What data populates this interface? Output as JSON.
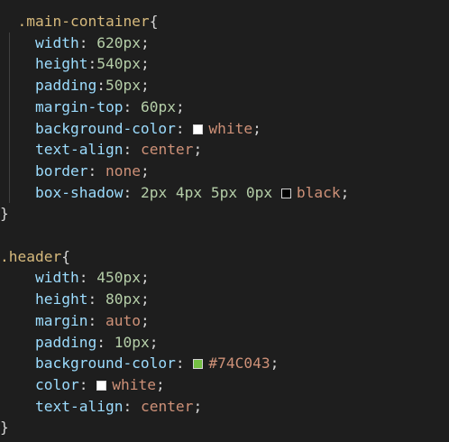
{
  "editor": {
    "lines": [
      [
        {
          "t": "  .main-container",
          "c": "selector"
        },
        {
          "t": "{",
          "c": "brace"
        }
      ],
      [
        {
          "t": "    width",
          "c": "prop"
        },
        {
          "t": ": ",
          "c": "colon"
        },
        {
          "t": "620px",
          "c": "num"
        },
        {
          "t": ";",
          "c": "semi"
        }
      ],
      [
        {
          "t": "    height",
          "c": "prop"
        },
        {
          "t": ":",
          "c": "colon"
        },
        {
          "t": "540px",
          "c": "num"
        },
        {
          "t": ";",
          "c": "semi"
        }
      ],
      [
        {
          "t": "    padding",
          "c": "prop"
        },
        {
          "t": ":",
          "c": "colon"
        },
        {
          "t": "50px",
          "c": "num"
        },
        {
          "t": ";",
          "c": "semi"
        }
      ],
      [
        {
          "t": "    margin-top",
          "c": "prop"
        },
        {
          "t": ": ",
          "c": "colon"
        },
        {
          "t": "60px",
          "c": "num"
        },
        {
          "t": ";",
          "c": "semi"
        }
      ],
      [
        {
          "t": "    background-color",
          "c": "prop"
        },
        {
          "t": ": ",
          "c": "colon"
        },
        {
          "swatch": "#ffffff"
        },
        {
          "t": "white",
          "c": "kw"
        },
        {
          "t": ";",
          "c": "semi"
        }
      ],
      [
        {
          "t": "    text-align",
          "c": "prop"
        },
        {
          "t": ": ",
          "c": "colon"
        },
        {
          "t": "center",
          "c": "kw"
        },
        {
          "t": ";",
          "c": "semi"
        }
      ],
      [
        {
          "t": "    border",
          "c": "prop"
        },
        {
          "t": ": ",
          "c": "colon"
        },
        {
          "t": "none",
          "c": "kw"
        },
        {
          "t": ";",
          "c": "semi"
        }
      ],
      [
        {
          "t": "    box-shadow",
          "c": "prop"
        },
        {
          "t": ": ",
          "c": "colon"
        },
        {
          "t": "2px 4px 5px 0px ",
          "c": "num"
        },
        {
          "swatch": "#000000"
        },
        {
          "t": "black",
          "c": "kw"
        },
        {
          "t": ";",
          "c": "semi"
        }
      ],
      [
        {
          "t": "}",
          "c": "brace"
        }
      ],
      [],
      [
        {
          "t": ".header",
          "c": "selector"
        },
        {
          "t": "{",
          "c": "brace"
        }
      ],
      [
        {
          "t": "    width",
          "c": "prop"
        },
        {
          "t": ": ",
          "c": "colon"
        },
        {
          "t": "450px",
          "c": "num"
        },
        {
          "t": ";",
          "c": "semi"
        }
      ],
      [
        {
          "t": "    height",
          "c": "prop"
        },
        {
          "t": ": ",
          "c": "colon"
        },
        {
          "t": "80px",
          "c": "num"
        },
        {
          "t": ";",
          "c": "semi"
        }
      ],
      [
        {
          "t": "    margin",
          "c": "prop"
        },
        {
          "t": ": ",
          "c": "colon"
        },
        {
          "t": "auto",
          "c": "kw"
        },
        {
          "t": ";",
          "c": "semi"
        }
      ],
      [
        {
          "t": "    padding",
          "c": "prop"
        },
        {
          "t": ": ",
          "c": "colon"
        },
        {
          "t": "10px",
          "c": "num"
        },
        {
          "t": ";",
          "c": "semi"
        }
      ],
      [
        {
          "t": "    background-color",
          "c": "prop"
        },
        {
          "t": ": ",
          "c": "colon"
        },
        {
          "swatch": "#74C043"
        },
        {
          "t": "#74C043",
          "c": "kw"
        },
        {
          "t": ";",
          "c": "semi"
        }
      ],
      [
        {
          "t": "    color",
          "c": "prop"
        },
        {
          "t": ": ",
          "c": "colon"
        },
        {
          "swatch": "#ffffff"
        },
        {
          "t": "white",
          "c": "kw"
        },
        {
          "t": ";",
          "c": "semi"
        }
      ],
      [
        {
          "t": "    text-align",
          "c": "prop"
        },
        {
          "t": ": ",
          "c": "colon"
        },
        {
          "t": "center",
          "c": "kw"
        },
        {
          "t": ";",
          "c": "semi"
        }
      ],
      [
        {
          "t": "}",
          "c": "brace"
        }
      ]
    ]
  },
  "colors": {
    "background": "#1e1e1e",
    "selector": "#d7ba7d",
    "property": "#9cdcfe",
    "number": "#b5cea8",
    "keyword": "#ce9178",
    "punctuation": "#d4d4d4"
  }
}
